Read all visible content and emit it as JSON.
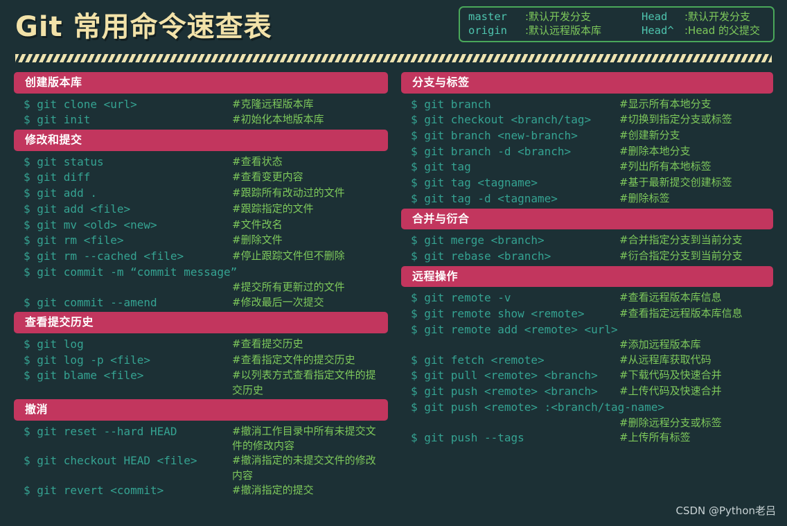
{
  "header": {
    "title": "Git 常用命令速查表",
    "legend": [
      {
        "term1": "master",
        "desc1": ":默认开发分支",
        "term2": "Head",
        "desc2": ":默认开发分支"
      },
      {
        "term1": "origin",
        "desc1": ":默认远程版本库",
        "term2": "Head^",
        "desc2": ":Head 的父提交"
      }
    ]
  },
  "colors": {
    "background": "#1c3035",
    "title": "#f2e2a9",
    "section_header_bg": "#c2365e",
    "command": "#35a392",
    "comment": "#7ec95b",
    "legend_term": "#4ec4ae",
    "legend_border": "#4aa85a",
    "stripe": "#eee3b0",
    "watermark": "#c8d2d4"
  },
  "left_column": [
    {
      "title": "创建版本库",
      "rows": [
        {
          "cmd": "$ git clone <url>",
          "note": "#克隆远程版本库"
        },
        {
          "cmd": "$ git init",
          "note": "#初始化本地版本库"
        }
      ]
    },
    {
      "title": "修改和提交",
      "rows": [
        {
          "cmd": "$ git status",
          "note": "#查看状态"
        },
        {
          "cmd": "$ git diff",
          "note": "#查看变更内容"
        },
        {
          "cmd": "$ git add .",
          "note": "#跟踪所有改动过的文件"
        },
        {
          "cmd": "$ git add <file>",
          "note": "#跟踪指定的文件"
        },
        {
          "cmd": "$ git mv <old> <new>",
          "note": "#文件改名"
        },
        {
          "cmd": "$ git rm <file>",
          "note": "#删除文件"
        },
        {
          "cmd": "$ git rm --cached <file>",
          "note": "#停止跟踪文件但不删除"
        },
        {
          "cmd": "$ git commit -m “commit message”",
          "note": "",
          "full": true
        },
        {
          "cmd": "",
          "note": "#提交所有更新过的文件"
        },
        {
          "cmd": "$ git commit --amend",
          "note": "#修改最后一次提交"
        }
      ]
    },
    {
      "title": "查看提交历史",
      "rows": [
        {
          "cmd": "$ git log",
          "note": "#查看提交历史"
        },
        {
          "cmd": "$ git log -p <file>",
          "note": "#查看指定文件的提交历史"
        },
        {
          "cmd": "$ git blame <file>",
          "note": "#以列表方式查看指定文件的提交历史",
          "wrap": true
        }
      ]
    },
    {
      "title": "撤消",
      "rows": [
        {
          "cmd": "$ git reset --hard HEAD",
          "note": "#撤消工作目录中所有未提交文件的修改内容",
          "wrap": true
        },
        {
          "cmd": "$ git checkout HEAD <file>",
          "note": "#撤消指定的未提交文件的修改内容",
          "wrap": true
        },
        {
          "cmd": "$ git revert <commit>",
          "note": "#撤消指定的提交"
        }
      ]
    }
  ],
  "right_column": [
    {
      "title": "分支与标签",
      "rows": [
        {
          "cmd": "$ git branch",
          "note": "#显示所有本地分支"
        },
        {
          "cmd": "$ git checkout <branch/tag>",
          "note": "#切换到指定分支或标签"
        },
        {
          "cmd": "$ git branch <new-branch>",
          "note": "#创建新分支"
        },
        {
          "cmd": "$ git branch -d <branch>",
          "note": "#删除本地分支"
        },
        {
          "cmd": "$ git tag",
          "note": "#列出所有本地标签"
        },
        {
          "cmd": "$ git tag <tagname>",
          "note": "#基于最新提交创建标签"
        },
        {
          "cmd": "$ git tag -d <tagname>",
          "note": "#删除标签"
        }
      ]
    },
    {
      "title": "合并与衍合",
      "rows": [
        {
          "cmd": "$ git merge <branch>",
          "note": "#合并指定分支到当前分支"
        },
        {
          "cmd": "$ git rebase <branch>",
          "note": "#衍合指定分支到当前分支"
        }
      ]
    },
    {
      "title": "远程操作",
      "rows": [
        {
          "cmd": "$ git remote -v",
          "note": "#查看远程版本库信息"
        },
        {
          "cmd": "$ git remote show <remote>",
          "note": "#查看指定远程版本库信息"
        },
        {
          "cmd": "$ git remote add <remote> <url>",
          "note": "",
          "full": true
        },
        {
          "cmd": "",
          "note": "#添加远程版本库"
        },
        {
          "cmd": "$ git fetch <remote>",
          "note": "#从远程库获取代码"
        },
        {
          "cmd": "$ git pull <remote> <branch>",
          "note": "#下载代码及快速合并"
        },
        {
          "cmd": "$ git push <remote> <branch>",
          "note": "#上传代码及快速合并"
        },
        {
          "cmd": "$ git push <remote> :<branch/tag-name>",
          "note": "",
          "full": true
        },
        {
          "cmd": "",
          "note": "#删除远程分支或标签"
        },
        {
          "cmd": "$ git push --tags",
          "note": "#上传所有标签"
        }
      ]
    }
  ],
  "watermark": "CSDN @Python老吕"
}
